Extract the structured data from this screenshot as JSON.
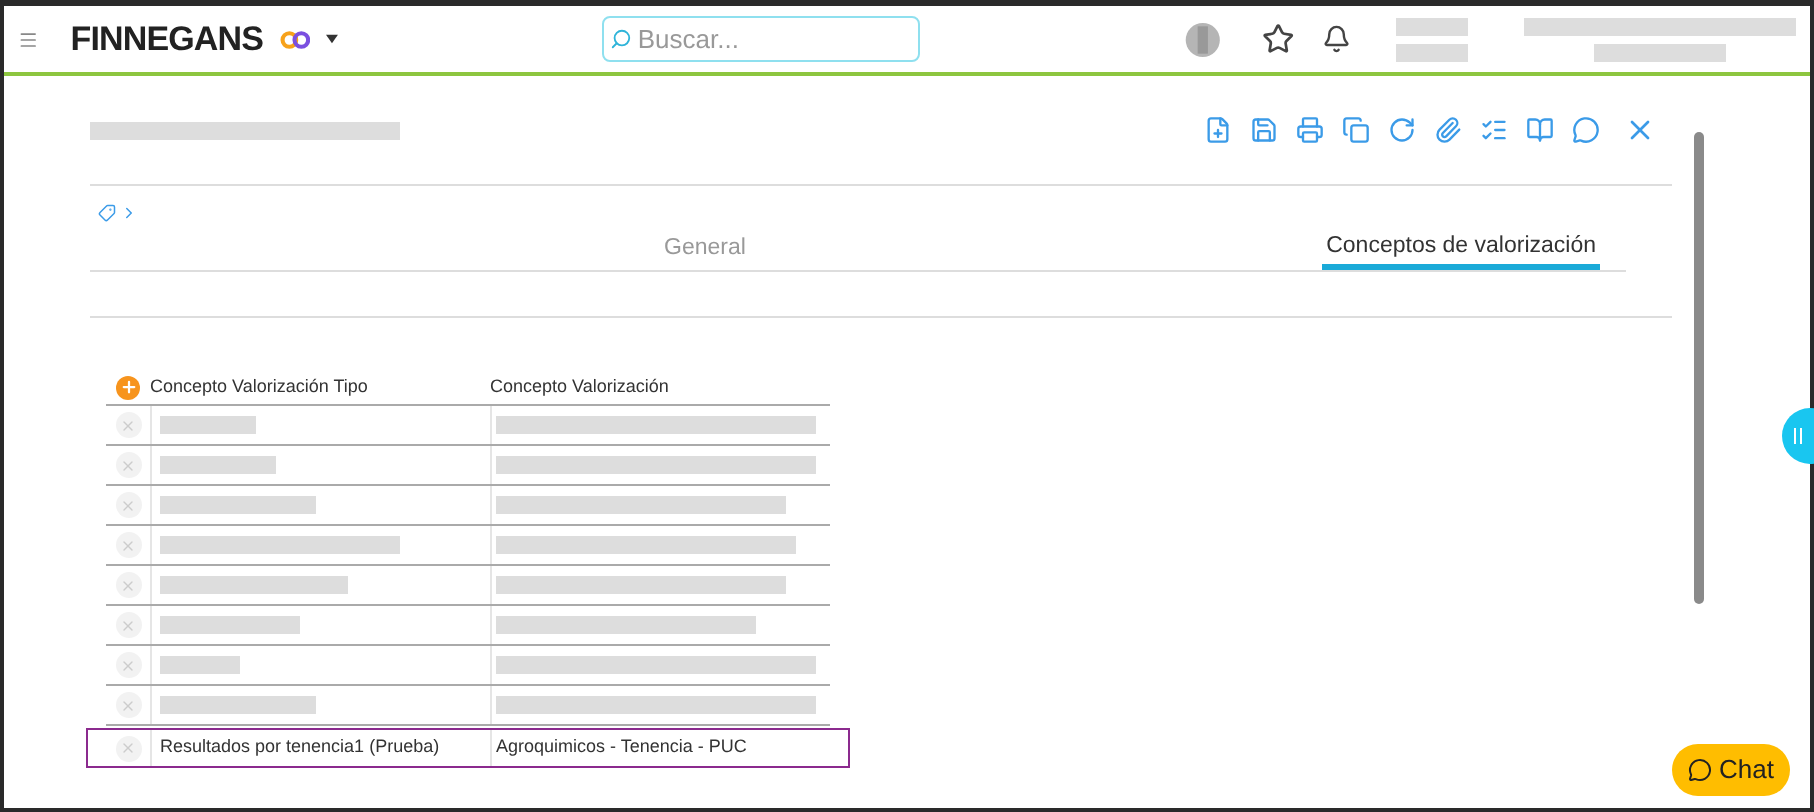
{
  "header": {
    "brand": "FINNEGANS",
    "search": {
      "placeholder": "Buscar..."
    }
  },
  "tabs": [
    {
      "label": "General",
      "selected": false
    },
    {
      "label": "Conceptos de valorización",
      "selected": true
    }
  ],
  "table": {
    "columns": [
      "Concepto Valorización Tipo",
      "Concepto Valorización"
    ],
    "rows": [
      {
        "kind": "redacted",
        "selected": false
      },
      {
        "kind": "redacted",
        "selected": false
      },
      {
        "kind": "redacted",
        "selected": false
      },
      {
        "kind": "redacted",
        "selected": false
      },
      {
        "kind": "redacted",
        "selected": false
      },
      {
        "kind": "redacted",
        "selected": false
      },
      {
        "kind": "redacted",
        "selected": false
      },
      {
        "kind": "redacted",
        "selected": false
      },
      {
        "kind": "text",
        "selected": true,
        "cells": [
          "Resultados por tenencia1 (Prueba)",
          "Agroquimicos - Tenencia - PUC"
        ]
      }
    ]
  },
  "chat": {
    "label": "Chat"
  }
}
